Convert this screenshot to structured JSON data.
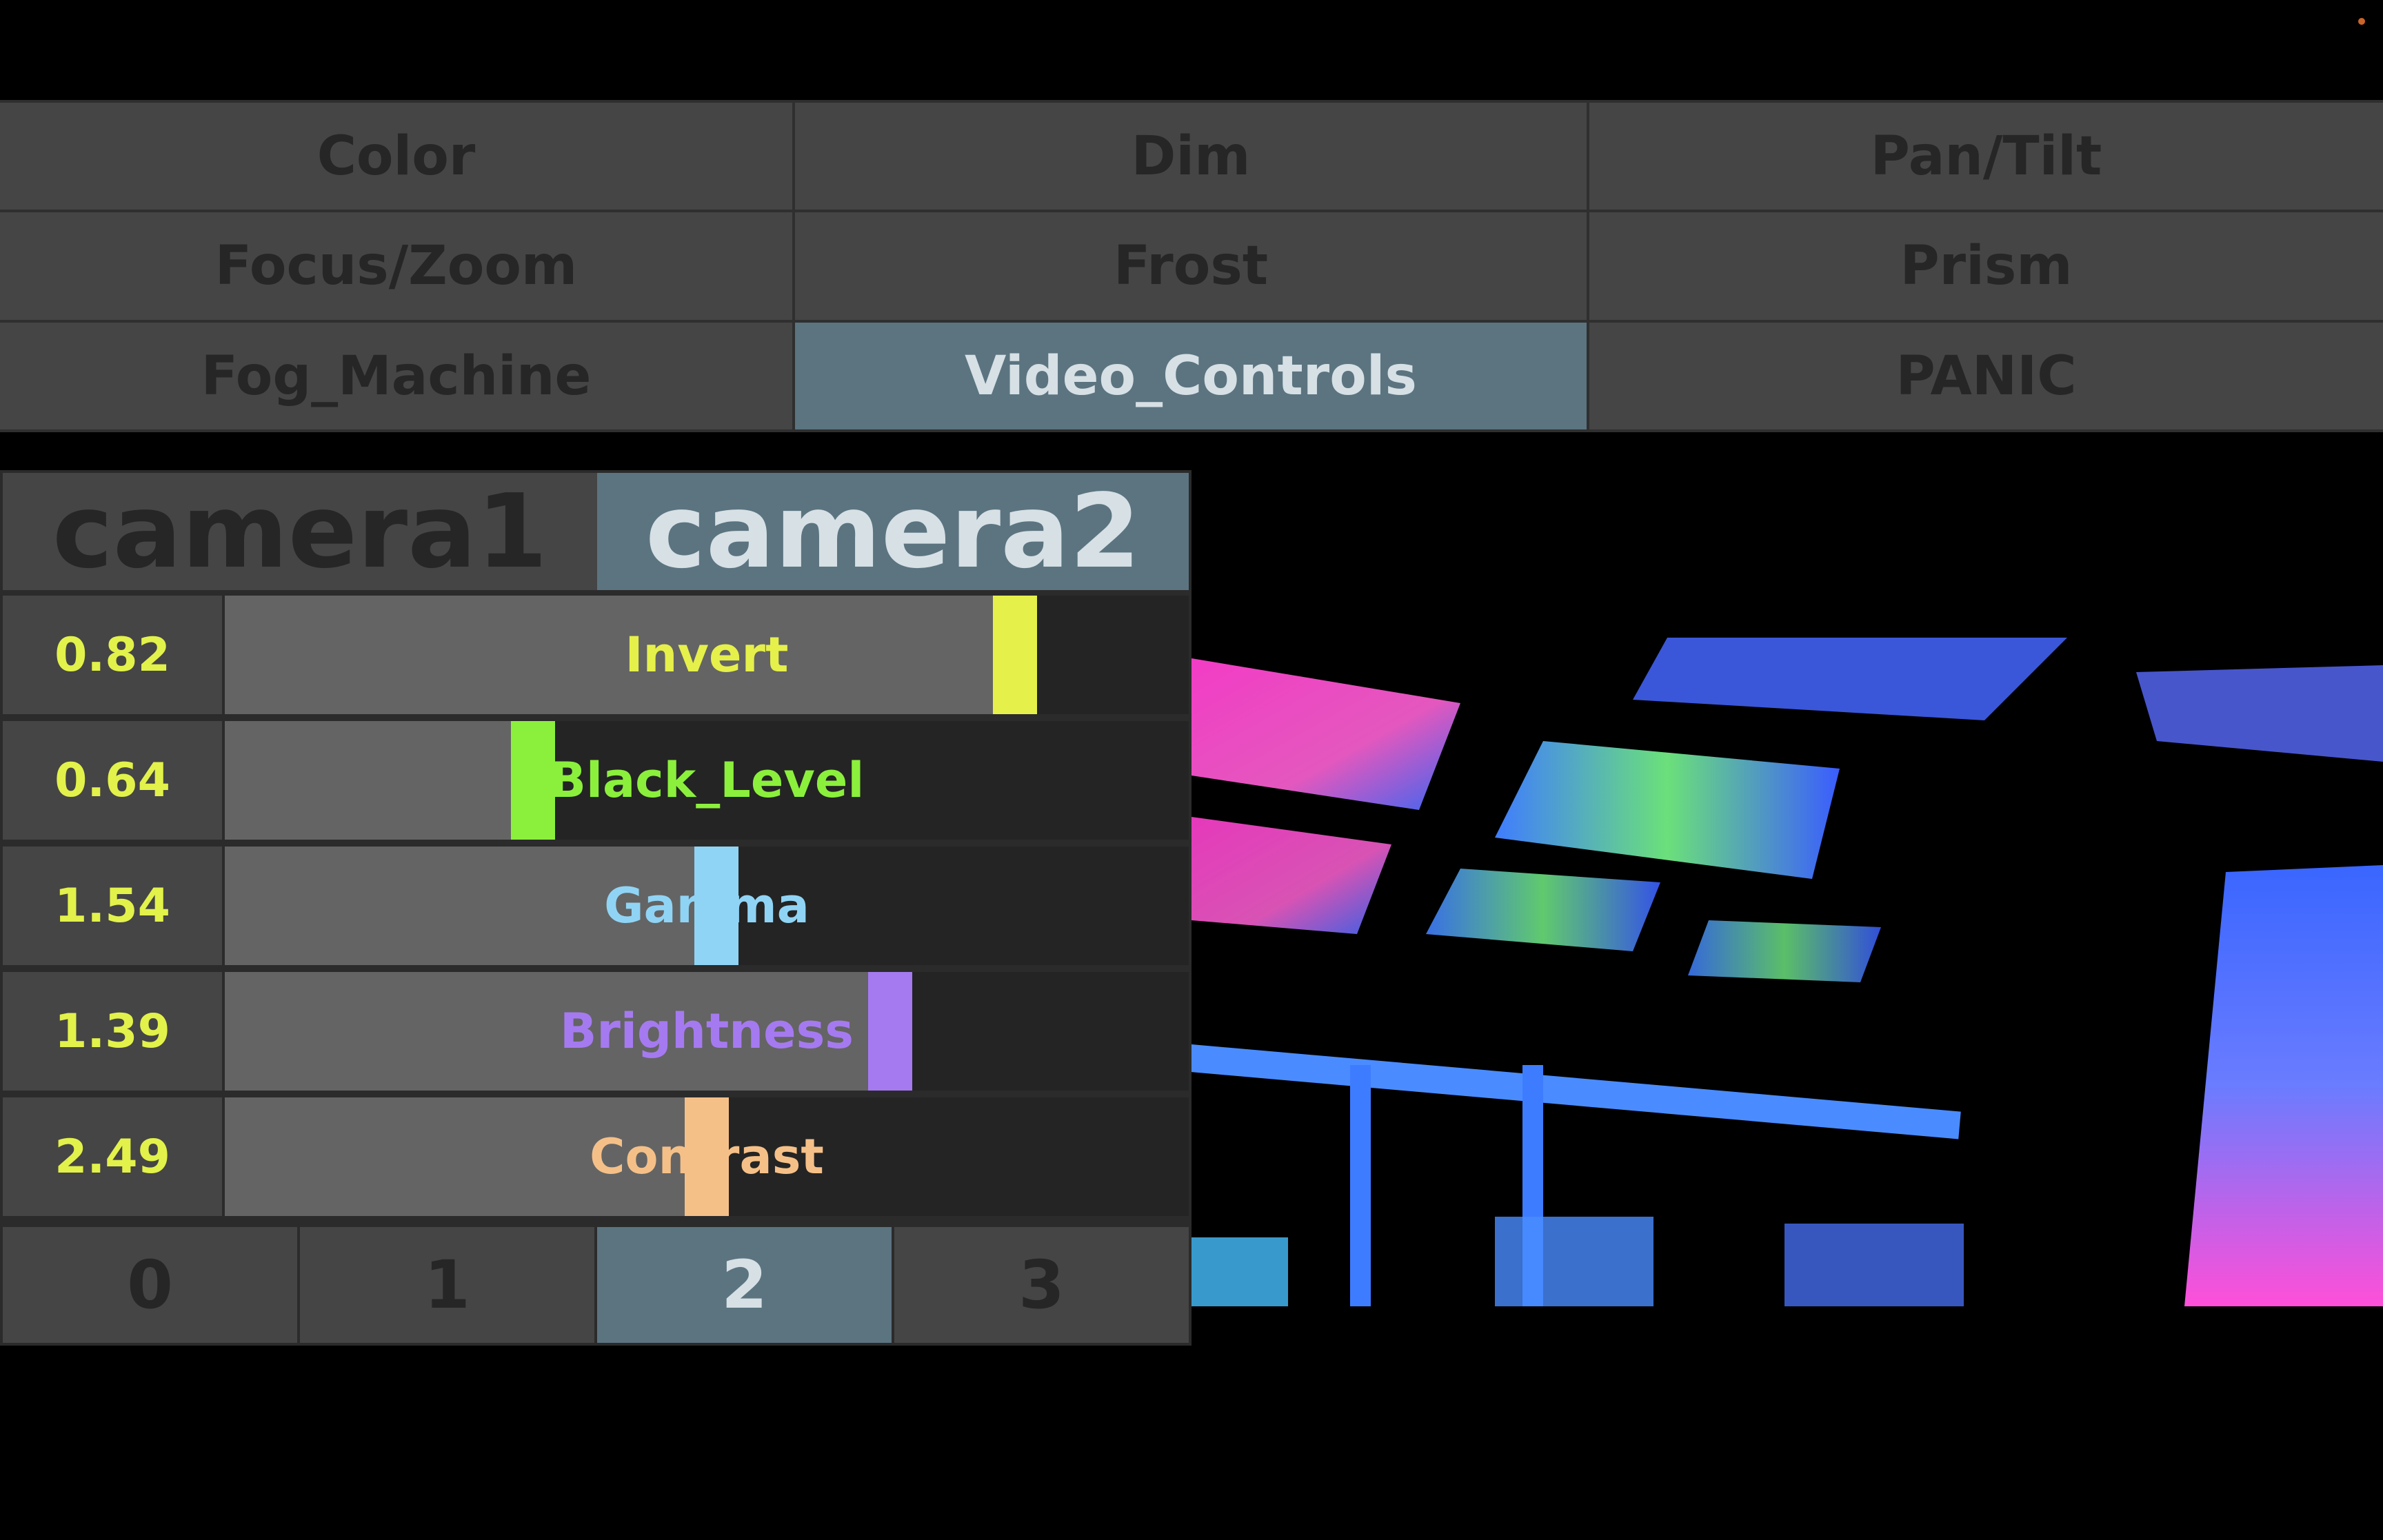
{
  "menu": {
    "items": [
      {
        "label": "Color",
        "active": false
      },
      {
        "label": "Dim",
        "active": false
      },
      {
        "label": "Pan/Tilt",
        "active": false
      },
      {
        "label": "Focus/Zoom",
        "active": false
      },
      {
        "label": "Frost",
        "active": false
      },
      {
        "label": "Prism",
        "active": false
      },
      {
        "label": "Fog_Machine",
        "active": false
      },
      {
        "label": "Video_Controls",
        "active": true
      },
      {
        "label": "PANIC",
        "active": false
      }
    ]
  },
  "cameras": {
    "tabs": [
      {
        "label": "camera1",
        "active": false
      },
      {
        "label": "camera2",
        "active": true
      }
    ]
  },
  "controls": [
    {
      "value_text": "0.82",
      "label": "Invert",
      "position": 0.82,
      "color": "#e6f04a"
    },
    {
      "value_text": "0.64",
      "label": "Black_Level",
      "position": 0.32,
      "color": "#8bf03c"
    },
    {
      "value_text": "1.54",
      "label": "Gamma",
      "position": 0.51,
      "color": "#90d4f5"
    },
    {
      "value_text": "1.39",
      "label": "Brightness",
      "position": 0.69,
      "color": "#a57af0"
    },
    {
      "value_text": "2.49",
      "label": "Contrast",
      "position": 0.5,
      "color": "#f5c088"
    }
  ],
  "pager": {
    "pages": [
      {
        "label": "0",
        "active": false
      },
      {
        "label": "1",
        "active": false
      },
      {
        "label": "2",
        "active": true
      },
      {
        "label": "3",
        "active": false
      }
    ]
  },
  "colors": {
    "value_text": "#e2f24a",
    "active_bg": "#5b7480",
    "button_bg": "#454545"
  }
}
